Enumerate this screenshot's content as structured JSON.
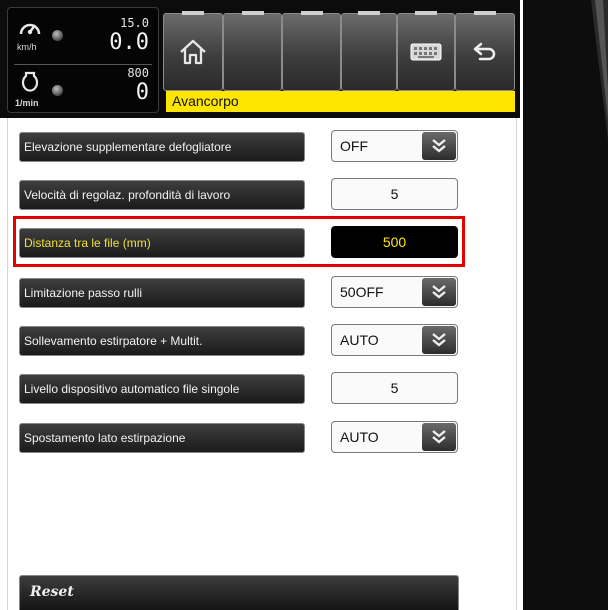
{
  "status": {
    "speed": {
      "unit": "km/h",
      "max": "15.0",
      "value": "0.0",
      "icon": "speedometer-icon"
    },
    "rpm": {
      "unit": "1/min",
      "max": "800",
      "value": "0",
      "icon": "engine-icon"
    }
  },
  "toolbar": {
    "buttons": [
      {
        "icon": "home-icon"
      },
      {
        "icon": "empty"
      },
      {
        "icon": "empty"
      },
      {
        "icon": "empty"
      },
      {
        "icon": "keyboard-icon"
      },
      {
        "icon": "back-arrow-icon"
      }
    ]
  },
  "breadcrumb": "Avancorpo",
  "settings": [
    {
      "label": "Elevazione supplementare defogliatore",
      "value": "OFF",
      "type": "dropdown"
    },
    {
      "label": "Velocità di regolaz. profondità di lavoro",
      "value": "5",
      "type": "number"
    },
    {
      "label": "Distanza tra le file (mm)",
      "value": "500",
      "type": "number",
      "selected": true
    },
    {
      "label": "Limitazione passo rulli",
      "value": "50OFF",
      "type": "dropdown"
    },
    {
      "label": "Sollevamento estirpatore + Multit.",
      "value": "AUTO",
      "type": "dropdown"
    },
    {
      "label": "Livello dispositivo automatico file singole",
      "value": "5",
      "type": "number"
    },
    {
      "label": "Spostamento lato estirpazione",
      "value": "AUTO",
      "type": "dropdown"
    }
  ],
  "footer": {
    "reset_label": "Reset"
  },
  "colors": {
    "accent": "#ffe600",
    "highlight": "#e40000",
    "active_text": "#f0e03a"
  }
}
